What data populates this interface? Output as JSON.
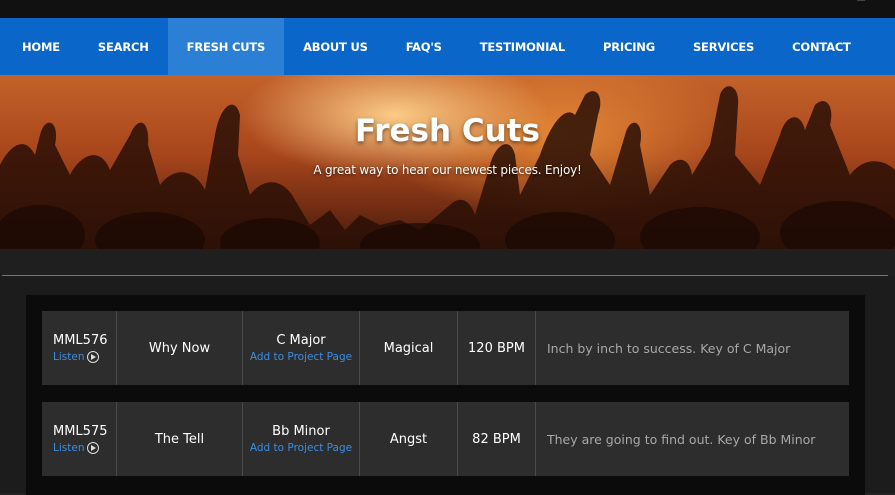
{
  "nav": {
    "items": [
      {
        "label": "HOME"
      },
      {
        "label": "SEARCH"
      },
      {
        "label": "FRESH CUTS"
      },
      {
        "label": "ABOUT US"
      },
      {
        "label": "FAQ'S"
      },
      {
        "label": "TESTIMONIAL"
      },
      {
        "label": "PRICING"
      },
      {
        "label": "SERVICES"
      },
      {
        "label": "CONTACT"
      }
    ],
    "active_index": 2
  },
  "hero": {
    "title": "Fresh Cuts",
    "subtitle": "A great way to hear our newest pieces. Enjoy!"
  },
  "tracks": [
    {
      "code": "MML576",
      "listen_label": "Listen",
      "title": "Why Now",
      "key": "C Major",
      "add_label": "Add to Project Page",
      "mood": "Magical",
      "bpm": "120 BPM",
      "description": "Inch by inch to success. Key of C Major"
    },
    {
      "code": "MML575",
      "listen_label": "Listen",
      "title": "The Tell",
      "key": "Bb Minor",
      "add_label": "Add to Project Page",
      "mood": "Angst",
      "bpm": "82 BPM",
      "description": "They are going to find out. Key of Bb Minor"
    }
  ],
  "colors": {
    "nav_bg": "#0a66c8",
    "nav_active": "#2b7fd4",
    "link": "#3d8de0",
    "row_bg": "#2d2d2d"
  }
}
